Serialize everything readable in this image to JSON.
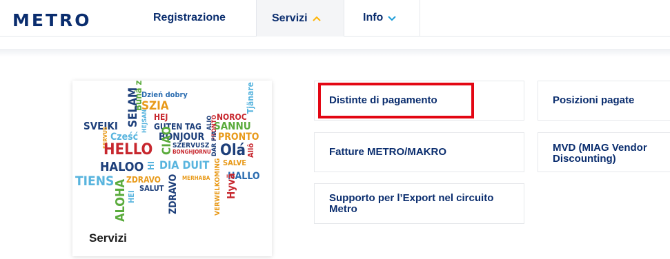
{
  "brand": {
    "logo_letters": [
      "M",
      "E",
      "T",
      "R",
      "O"
    ],
    "logo_colors": [
      "#0a2d6e",
      "#0a2d6e",
      "#0a2d6e",
      "#0a2d6e",
      "#0a2d6e"
    ],
    "logo_accent": "#ffe600"
  },
  "nav": {
    "items": [
      {
        "label": "Registrazione",
        "icon": null
      },
      {
        "label": "Servizi",
        "icon": "chevron-up-icon",
        "active": true
      },
      {
        "label": "Info",
        "icon": "chevron-down-icon"
      }
    ]
  },
  "servizi_card": {
    "title": "Servizi",
    "wordcloud_words": [
      "Bună ziua",
      "Dzień dobry",
      "SZIA",
      "SELAM",
      "HEJ",
      "NOROC",
      "Tjänare",
      "SVEIKI",
      "HEJSAN",
      "GUTEN TAG",
      "ALIO",
      "SANNU",
      "SERVUS",
      "Cześć",
      "BONJOUR",
      "PRONTO",
      "HELLO",
      "CIAO",
      "SZERVUSZ",
      "BONGHJORNU",
      "DAR FIA",
      "Olá",
      "Allô",
      "HALOO",
      "HI",
      "DIA DUIT",
      "SALVE",
      "TIENS",
      "ZDRAVO",
      "MERHABA",
      "HALLO",
      "ALOHA",
      "HEI",
      "SALUT",
      "ZDRAVO",
      "VERWELKOMING",
      "Hyvä"
    ]
  },
  "links": [
    {
      "label": "Distinte di pagamento",
      "highlighted": true
    },
    {
      "label": "Posizioni pagate"
    },
    {
      "label": "Fatture METRO/MAKRO"
    },
    {
      "label": "MVD (MIAG Vendor Discounting)"
    },
    {
      "label": "Supporto per l’Export nel circuito Metro"
    }
  ],
  "colors": {
    "navy": "#0a2d6e",
    "highlight": "#e30613",
    "accent": "#ffb300"
  }
}
